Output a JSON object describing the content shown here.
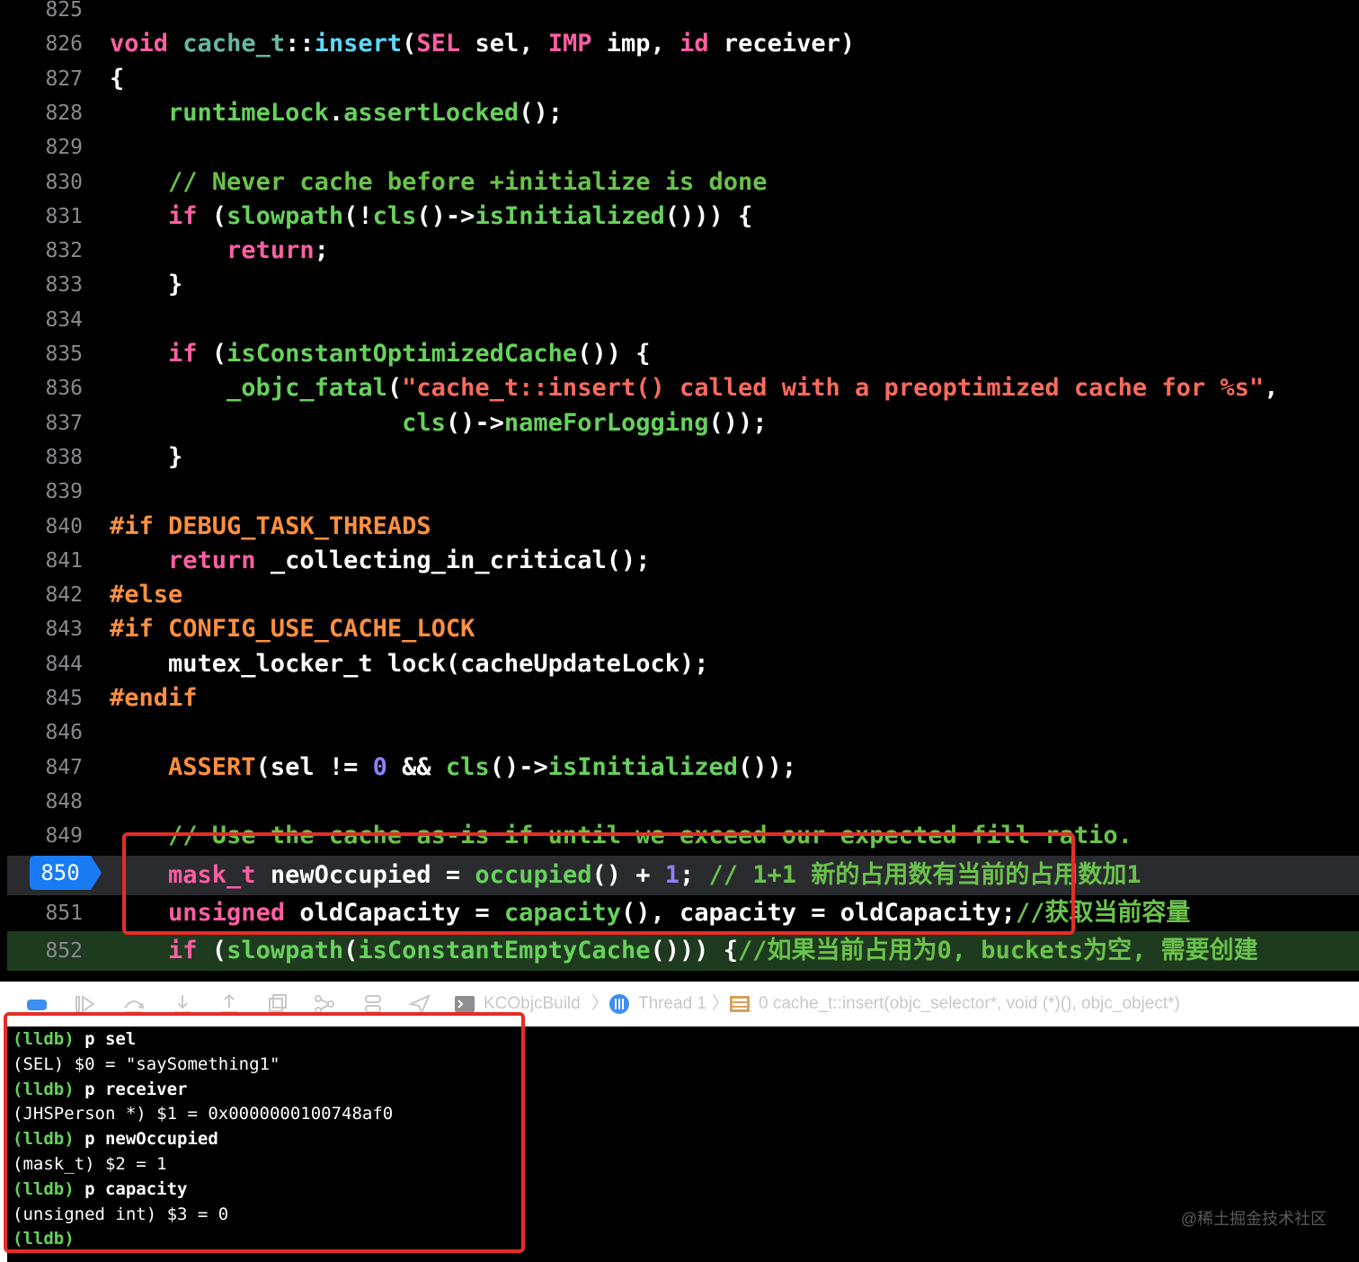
{
  "editor": {
    "lines": [
      {
        "no": "825",
        "tokens": []
      },
      {
        "no": "826",
        "tokens": [
          {
            "t": "void",
            "c": "kw"
          },
          {
            "t": " "
          },
          {
            "t": "cache_t",
            "c": "fn"
          },
          {
            "t": "::"
          },
          {
            "t": "insert",
            "c": "ty"
          },
          {
            "t": "("
          },
          {
            "t": "SEL",
            "c": "kw"
          },
          {
            "t": " sel, "
          },
          {
            "t": "IMP",
            "c": "kw"
          },
          {
            "t": " imp, "
          },
          {
            "t": "id",
            "c": "kw"
          },
          {
            "t": " receiver)"
          }
        ]
      },
      {
        "no": "827",
        "tokens": [
          {
            "t": "{"
          }
        ]
      },
      {
        "no": "828",
        "tokens": [
          {
            "t": "    "
          },
          {
            "t": "runtimeLock",
            "c": "mth"
          },
          {
            "t": "."
          },
          {
            "t": "assertLocked",
            "c": "mth"
          },
          {
            "t": "();"
          }
        ]
      },
      {
        "no": "829",
        "tokens": []
      },
      {
        "no": "830",
        "tokens": [
          {
            "t": "    "
          },
          {
            "t": "// Never cache before +initialize is done",
            "c": "cmt"
          }
        ]
      },
      {
        "no": "831",
        "tokens": [
          {
            "t": "    "
          },
          {
            "t": "if",
            "c": "kw"
          },
          {
            "t": " ("
          },
          {
            "t": "slowpath",
            "c": "mth"
          },
          {
            "t": "(!"
          },
          {
            "t": "cls",
            "c": "mth"
          },
          {
            "t": "()->"
          },
          {
            "t": "isInitialized",
            "c": "mth"
          },
          {
            "t": "())) {"
          }
        ]
      },
      {
        "no": "832",
        "tokens": [
          {
            "t": "        "
          },
          {
            "t": "return",
            "c": "kw"
          },
          {
            "t": ";"
          }
        ]
      },
      {
        "no": "833",
        "tokens": [
          {
            "t": "    }"
          }
        ]
      },
      {
        "no": "834",
        "tokens": []
      },
      {
        "no": "835",
        "tokens": [
          {
            "t": "    "
          },
          {
            "t": "if",
            "c": "kw"
          },
          {
            "t": " ("
          },
          {
            "t": "isConstantOptimizedCache",
            "c": "mth"
          },
          {
            "t": "()) {"
          }
        ]
      },
      {
        "no": "836",
        "tokens": [
          {
            "t": "        "
          },
          {
            "t": "_objc_fatal",
            "c": "mth"
          },
          {
            "t": "("
          },
          {
            "t": "\"cache_t::insert() called with a preoptimized cache for %s\"",
            "c": "str"
          },
          {
            "t": ","
          }
        ]
      },
      {
        "no": "837",
        "tokens": [
          {
            "t": "                    "
          },
          {
            "t": "cls",
            "c": "mth"
          },
          {
            "t": "()->"
          },
          {
            "t": "nameForLogging",
            "c": "mth"
          },
          {
            "t": "());"
          }
        ]
      },
      {
        "no": "838",
        "tokens": [
          {
            "t": "    }"
          }
        ]
      },
      {
        "no": "839",
        "tokens": []
      },
      {
        "no": "840",
        "tokens": [
          {
            "t": "#if DEBUG_TASK_THREADS",
            "c": "pp"
          }
        ]
      },
      {
        "no": "841",
        "tokens": [
          {
            "t": "    "
          },
          {
            "t": "return",
            "c": "kw"
          },
          {
            "t": " _collecting_in_critical();"
          }
        ]
      },
      {
        "no": "842",
        "tokens": [
          {
            "t": "#else",
            "c": "pp"
          }
        ]
      },
      {
        "no": "843",
        "tokens": [
          {
            "t": "#if CONFIG_USE_CACHE_LOCK",
            "c": "pp"
          }
        ]
      },
      {
        "no": "844",
        "tokens": [
          {
            "t": "    mutex_locker_t lock(cacheUpdateLock);"
          }
        ]
      },
      {
        "no": "845",
        "tokens": [
          {
            "t": "#endif",
            "c": "pp"
          }
        ]
      },
      {
        "no": "846",
        "tokens": []
      },
      {
        "no": "847",
        "tokens": [
          {
            "t": "    "
          },
          {
            "t": "ASSERT",
            "c": "pp"
          },
          {
            "t": "(sel != "
          },
          {
            "t": "0",
            "c": "num"
          },
          {
            "t": " && "
          },
          {
            "t": "cls",
            "c": "mth"
          },
          {
            "t": "()->"
          },
          {
            "t": "isInitialized",
            "c": "mth"
          },
          {
            "t": "());"
          }
        ]
      },
      {
        "no": "848",
        "tokens": []
      },
      {
        "no": "849",
        "tokens": [
          {
            "t": "    "
          },
          {
            "t": "// Use the cache as-is if until we exceed our expected fill ratio.",
            "c": "cmt"
          }
        ]
      },
      {
        "no": "850",
        "tokens": [
          {
            "t": "    "
          },
          {
            "t": "mask_t",
            "c": "kw"
          },
          {
            "t": " newOccupied = "
          },
          {
            "t": "occupied",
            "c": "mth"
          },
          {
            "t": "() + "
          },
          {
            "t": "1",
            "c": "num"
          },
          {
            "t": "; "
          },
          {
            "t": "// 1+1 新的占用数有当前的占用数加1",
            "c": "cmt"
          }
        ]
      },
      {
        "no": "851",
        "tokens": [
          {
            "t": "    "
          },
          {
            "t": "unsigned",
            "c": "kw"
          },
          {
            "t": " oldCapacity = "
          },
          {
            "t": "capacity",
            "c": "mth"
          },
          {
            "t": "(), capacity = oldCapacity;"
          },
          {
            "t": "//获取当前容量",
            "c": "cmt"
          }
        ]
      },
      {
        "no": "852",
        "tokens": [
          {
            "t": "    "
          },
          {
            "t": "if",
            "c": "kw"
          },
          {
            "t": " ("
          },
          {
            "t": "slowpath",
            "c": "mth"
          },
          {
            "t": "("
          },
          {
            "t": "isConstantEmptyCache",
            "c": "mth"
          },
          {
            "t": "())) {"
          },
          {
            "t": "//如果当前占用为0, buckets为空, 需要创建",
            "c": "cmt"
          }
        ]
      }
    ]
  },
  "breakpoint": {
    "line": "850"
  },
  "debug_bar": {
    "target": "KCObjcBuild",
    "thread": "Thread 1",
    "frame": "0 cache_t::insert(objc_selector*, void (*)(), objc_object*)"
  },
  "console": {
    "lines": [
      {
        "prompt": "(lldb)",
        "text": " p sel"
      },
      {
        "prompt": "",
        "text": "(SEL) $0 = \"saySomething1\""
      },
      {
        "prompt": "(lldb)",
        "text": " p receiver"
      },
      {
        "prompt": "",
        "text": "(JHSPerson *) $1 = 0x0000000100748af0"
      },
      {
        "prompt": "(lldb)",
        "text": " p newOccupied"
      },
      {
        "prompt": "",
        "text": "(mask_t) $2 = 1"
      },
      {
        "prompt": "(lldb)",
        "text": " p capacity"
      },
      {
        "prompt": "",
        "text": "(unsigned int) $3 = 0"
      },
      {
        "prompt": "(lldb)",
        "text": ""
      }
    ]
  },
  "watermark": "@稀土掘金技术社区"
}
